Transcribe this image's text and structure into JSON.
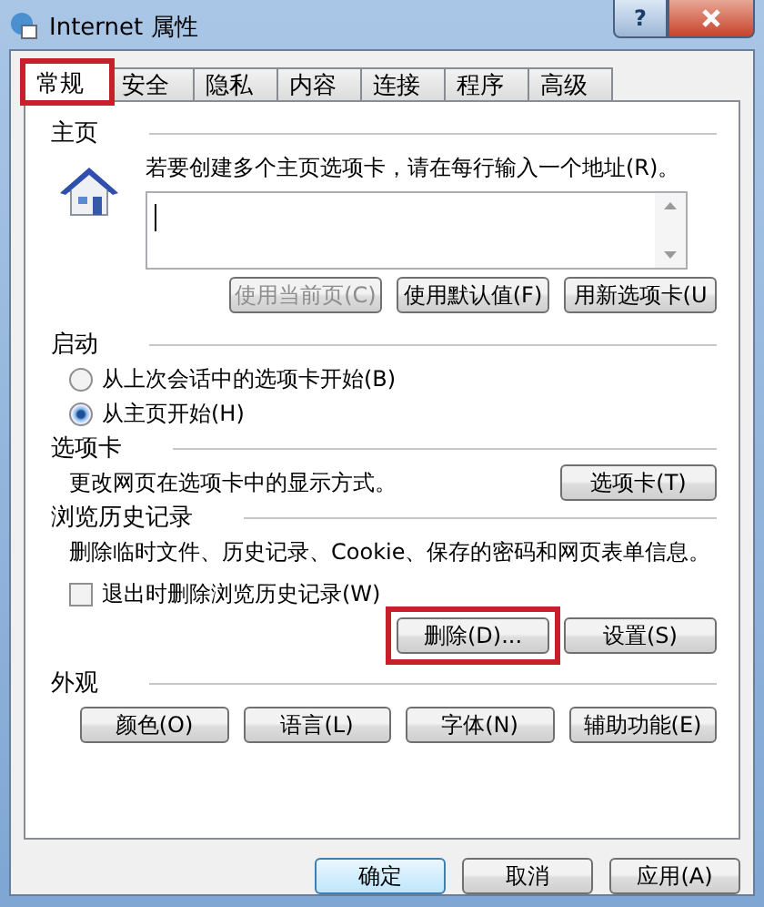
{
  "window": {
    "title": "Internet 属性",
    "help": "?"
  },
  "tabs": [
    {
      "label": "常规",
      "selected": true,
      "highlighted": true
    },
    {
      "label": "安全",
      "selected": false,
      "highlighted": false
    },
    {
      "label": "隐私",
      "selected": false,
      "highlighted": false
    },
    {
      "label": "内容",
      "selected": false,
      "highlighted": false
    },
    {
      "label": "连接",
      "selected": false,
      "highlighted": false
    },
    {
      "label": "程序",
      "selected": false,
      "highlighted": false
    },
    {
      "label": "高级",
      "selected": false,
      "highlighted": false
    }
  ],
  "homepage": {
    "heading": "主页",
    "hint": "若要创建多个主页选项卡，请在每行输入一个地址(R)。",
    "buttons": [
      {
        "label": "使用当前页(C)",
        "disabled": true
      },
      {
        "label": "使用默认值(F)",
        "disabled": false
      },
      {
        "label": "用新选项卡(U",
        "disabled": false
      }
    ]
  },
  "startup": {
    "heading": "启动",
    "options": [
      {
        "label": "从上次会话中的选项卡开始(B)",
        "selected": false
      },
      {
        "label": "从主页开始(H)",
        "selected": true
      }
    ]
  },
  "tab_settings": {
    "heading": "选项卡",
    "description": "更改网页在选项卡中的显示方式。",
    "button": "选项卡(T)"
  },
  "history": {
    "heading": "浏览历史记录",
    "description": "删除临时文件、历史记录、Cookie、保存的密码和网页表单信息。",
    "checkbox": {
      "label": "退出时删除浏览历史记录(W)",
      "checked": false
    },
    "buttons": [
      {
        "label": "删除(D)...",
        "highlighted": true
      },
      {
        "label": "设置(S)",
        "highlighted": false
      }
    ]
  },
  "appearance": {
    "heading": "外观",
    "buttons": [
      "颜色(O)",
      "语言(L)",
      "字体(N)",
      "辅助功能(E)"
    ]
  },
  "footer": [
    {
      "label": "确定",
      "default": true
    },
    {
      "label": "取消",
      "default": false
    },
    {
      "label": "应用(A)",
      "default": false
    }
  ]
}
